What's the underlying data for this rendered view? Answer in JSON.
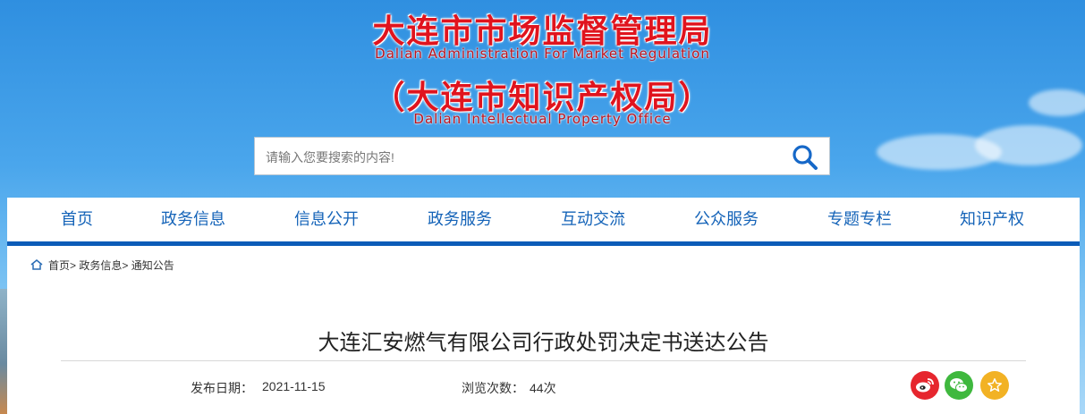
{
  "header": {
    "title_cn": "大连市市场监督管理局",
    "title_en": "Dalian Administration For Market Regulation",
    "subtitle_cn": "（大连市知识产权局）",
    "subtitle_en": "Dalian Intellectual Property Office"
  },
  "search": {
    "placeholder": "请输入您要搜索的内容!",
    "icon": "search-icon"
  },
  "nav": {
    "items": [
      {
        "label": "首页"
      },
      {
        "label": "政务信息"
      },
      {
        "label": "信息公开"
      },
      {
        "label": "政务服务"
      },
      {
        "label": "互动交流"
      },
      {
        "label": "公众服务"
      },
      {
        "label": "专题专栏"
      },
      {
        "label": "知识产权"
      }
    ],
    "accent_color": "#0b5cb8"
  },
  "breadcrumb": {
    "icon": "home-icon",
    "items": [
      "首页>",
      "政务信息>",
      "通知公告"
    ]
  },
  "article": {
    "title": "大连汇安燃气有限公司行政处罚决定书送达公告",
    "date_label": "发布日期：",
    "date_value": "2021-11-15",
    "views_label": "浏览次数：",
    "views_value": "44次"
  },
  "share": {
    "weibo_color": "#e6262e",
    "wechat_color": "#3fb83e",
    "favorite_color": "#f2b224"
  }
}
